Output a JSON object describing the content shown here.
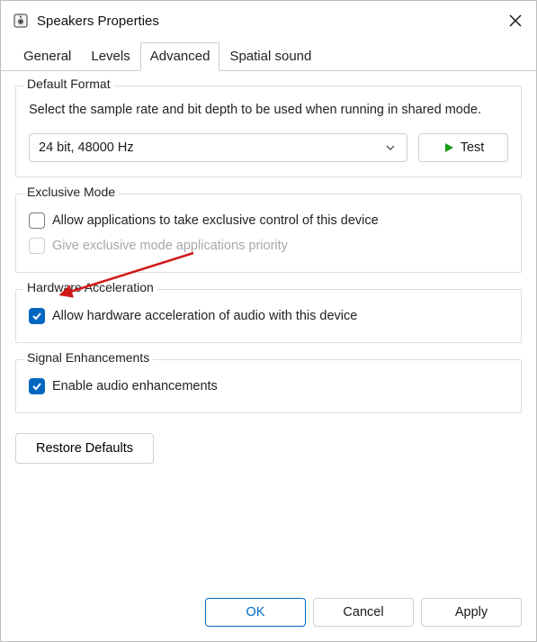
{
  "window": {
    "title": "Speakers Properties"
  },
  "tabs": {
    "items": [
      {
        "label": "General"
      },
      {
        "label": "Levels"
      },
      {
        "label": "Advanced"
      },
      {
        "label": "Spatial sound"
      }
    ],
    "active_index": 2
  },
  "default_format": {
    "legend": "Default Format",
    "description": "Select the sample rate and bit depth to be used when running in shared mode.",
    "selected": "24 bit, 48000 Hz",
    "test_label": "Test"
  },
  "exclusive_mode": {
    "legend": "Exclusive Mode",
    "opt1": {
      "label": "Allow applications to take exclusive control of this device",
      "checked": false,
      "enabled": true
    },
    "opt2": {
      "label": "Give exclusive mode applications priority",
      "checked": false,
      "enabled": false
    }
  },
  "hardware_accel": {
    "legend": "Hardware Acceleration",
    "opt": {
      "label": "Allow hardware acceleration of audio with this device",
      "checked": true
    }
  },
  "signal_enh": {
    "legend": "Signal Enhancements",
    "opt": {
      "label": "Enable audio enhancements",
      "checked": true
    }
  },
  "restore_label": "Restore Defaults",
  "footer": {
    "ok": "OK",
    "cancel": "Cancel",
    "apply": "Apply"
  }
}
